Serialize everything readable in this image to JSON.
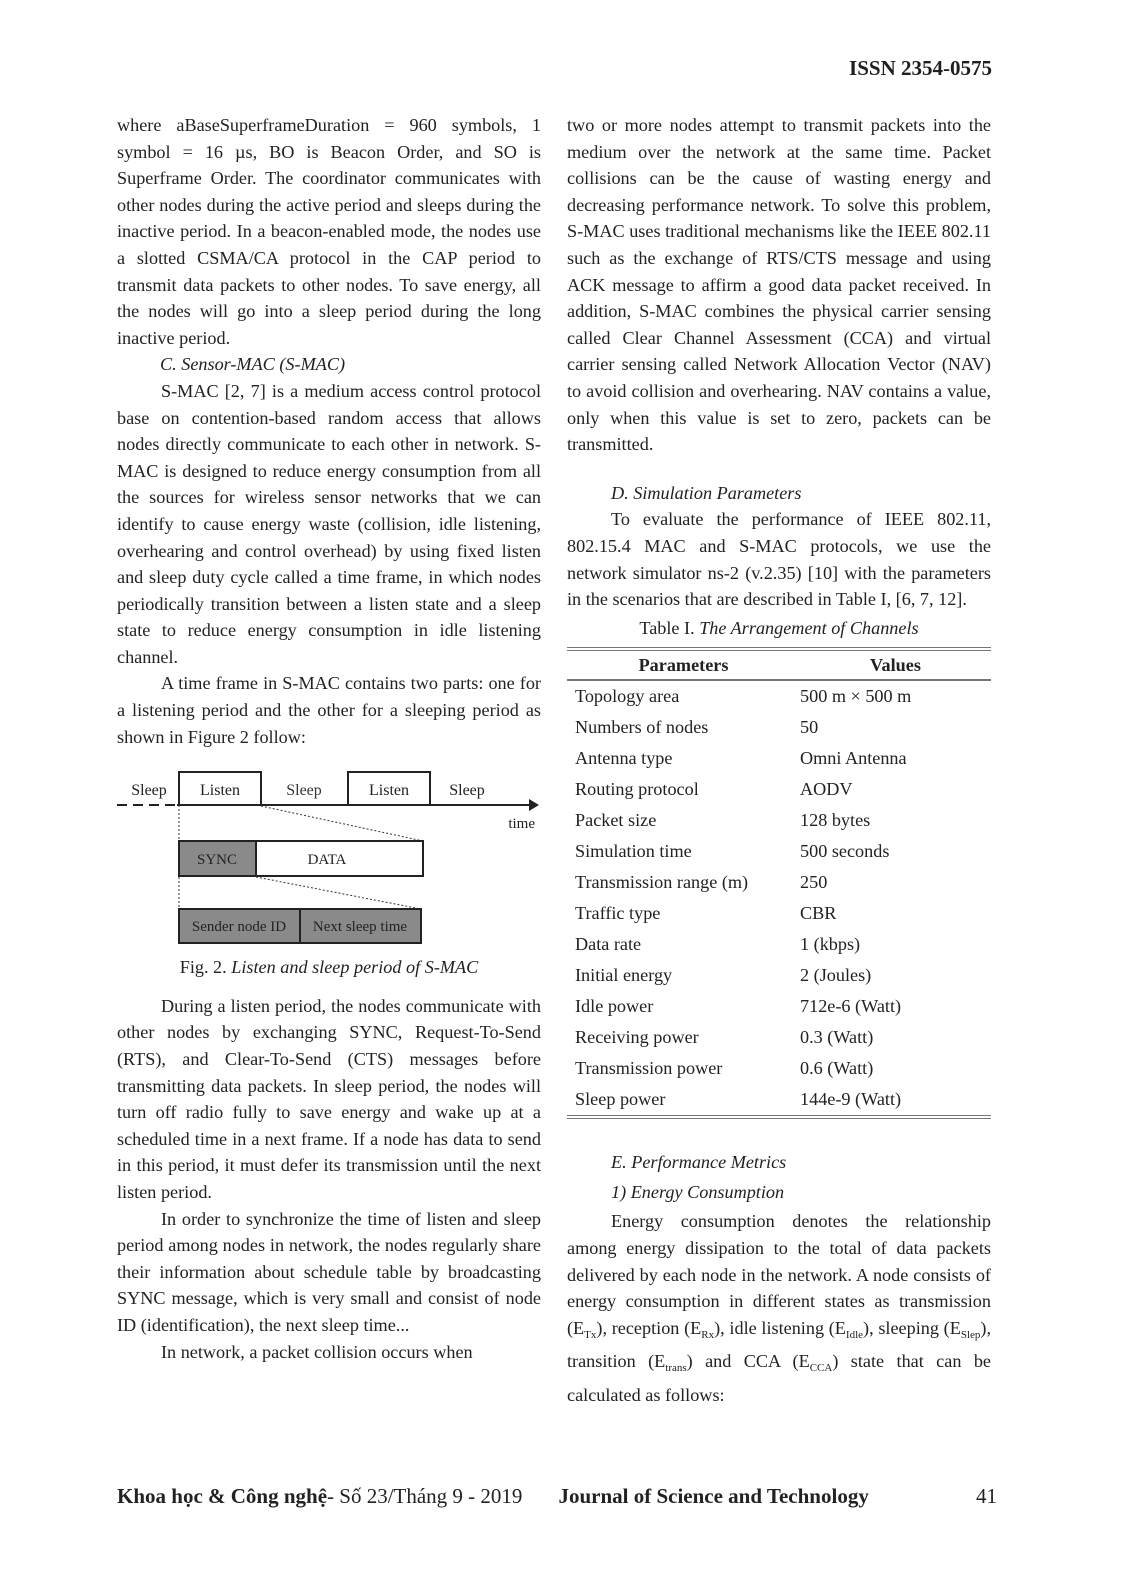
{
  "header": {
    "issn": "ISSN 2354-0575"
  },
  "left_column": {
    "p1": "where aBaseSuperframeDuration = 960 symbols, 1 symbol = 16 µs, BO is Beacon Order, and SO is Superframe Order. The coordinator communicates with other nodes during the active period and sleeps during the inactive period. In a beacon-enabled mode, the nodes use a slotted CSMA/CA protocol in the CAP period to transmit data packets to other nodes. To save energy, all the nodes will go into a sleep period during the long inactive period.",
    "section_c_heading": "C. Sensor-MAC (S-MAC)",
    "p2": "S-MAC [2, 7] is a medium access control protocol base on contention-based random access that allows nodes directly communicate to each other in network. S-MAC is designed to reduce energy consumption from all the sources for wireless sensor networks that we can identify to cause energy waste (collision, idle listening, overhearing and control overhead) by using fixed listen and sleep duty cycle called a time frame, in which nodes periodically transition between a listen state and a sleep state to reduce energy consumption in idle listening channel.",
    "p3": "A time frame in S-MAC contains two parts: one for a listening period and the other for a sleeping period as shown in Figure 2 follow:",
    "figure": {
      "timeline_labels": [
        "Sleep",
        "Listen",
        "Sleep",
        "Listen",
        "Sleep"
      ],
      "axis_label": "time",
      "frame_blocks": [
        "SYNC",
        "DATA"
      ],
      "sync_blocks": [
        "Sender node ID",
        "Next sleep time"
      ],
      "caption_prefix": "Fig. 2.",
      "caption_text": "Listen and sleep period of S-MAC"
    },
    "p4": "During a listen period, the nodes communicate with other nodes by exchanging SYNC, Request-To-Send (RTS), and Clear-To-Send (CTS) messages before transmitting data packets. In sleep period, the nodes will turn off radio fully to save energy and wake up at a scheduled time in a next frame. If a node has data to send in this period, it must defer its transmission until the next listen period.",
    "p5": "In order to synchronize the time of listen and sleep period among nodes in network, the nodes regularly share their information about schedule table by broadcasting SYNC message, which is very small and consist of node ID (identification), the next sleep time...",
    "p6": "In network, a packet collision occurs when"
  },
  "right_column": {
    "p1": "two or more nodes attempt to transmit packets into the medium over the network at the same time. Packet collisions can be the cause of wasting energy and decreasing performance network. To solve this problem, S-MAC uses traditional mechanisms like the IEEE 802.11 such as the exchange of RTS/CTS message and using ACK message to affirm a good data packet received. In addition, S-MAC combines the physical carrier sensing called Clear Channel Assessment (CCA) and virtual carrier sensing called Network Allocation Vector (NAV) to avoid collision and overhearing. NAV contains a value, only when this value is set to zero, packets can be transmitted.",
    "section_d_heading": "D.  Simulation Parameters",
    "p2": "To evaluate the performance of IEEE 802.11, 802.15.4 MAC and S-MAC protocols, we use the network simulator ns-2 (v.2.35) [10] with the parameters in the scenarios that are described in Table I, [6, 7, 12].",
    "table": {
      "caption_prefix": "Table I.",
      "caption_text": "The Arrangement of Channels",
      "headers": [
        "Parameters",
        "Values"
      ],
      "rows": [
        [
          "Topology area",
          "500 m × 500 m"
        ],
        [
          "Numbers of nodes",
          "50"
        ],
        [
          "Antenna type",
          "Omni Antenna"
        ],
        [
          "Routing protocol",
          "AODV"
        ],
        [
          "Packet size",
          "128 bytes"
        ],
        [
          "Simulation time",
          "500 seconds"
        ],
        [
          "Transmission range (m)",
          "250"
        ],
        [
          "Traffic type",
          "CBR"
        ],
        [
          "Data rate",
          "1 (kbps)"
        ],
        [
          "Initial energy",
          "2 (Joules)"
        ],
        [
          "Idle power",
          "712e-6 (Watt)"
        ],
        [
          "Receiving power",
          "0.3 (Watt)"
        ],
        [
          "Transmission power",
          "0.6 (Watt)"
        ],
        [
          "Sleep power",
          "144e-9 (Watt)"
        ]
      ]
    },
    "section_e_heading": "E.  Performance Metrics",
    "subsection_1_heading": "1)  Energy Consumption",
    "p3_a": "Energy consumption denotes the relationship among energy dissipation to the total of data packets delivered by each node in the network. A node consists of energy consumption in different states as transmission (E",
    "sub_tx": "Tx",
    "p3_b": "), reception (E",
    "sub_rx": "Rx",
    "p3_c": "), idle listening (E",
    "sub_idle": "Idle",
    "p3_d": "), sleeping (E",
    "sub_slep": "Slep",
    "p3_e": "), transition (E",
    "sub_trans": "trans",
    "p3_f": ") and CCA (E",
    "sub_cca": "CCA",
    "p3_g": ") state that can be calculated as follows:"
  },
  "footer": {
    "vn_title": "Khoa học & Công nghệ",
    "issue": " - Số 23/Tháng 9 - 2019",
    "journal": "Journal of Science and Technology",
    "page_number": "41"
  }
}
